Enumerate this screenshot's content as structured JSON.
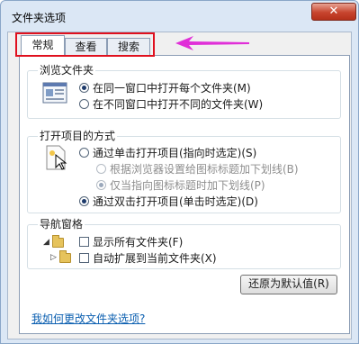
{
  "window": {
    "title": "文件夹选项",
    "close_label": "✕"
  },
  "tabs": [
    {
      "label": "常规",
      "active": true
    },
    {
      "label": "查看",
      "active": false
    },
    {
      "label": "搜索",
      "active": false
    }
  ],
  "browse_group": {
    "title": "浏览文件夹",
    "options": [
      {
        "label": "在同一窗口中打开每个文件夹(M)",
        "checked": true
      },
      {
        "label": "在不同窗口中打开不同的文件夹(W)",
        "checked": false
      }
    ]
  },
  "click_group": {
    "title": "打开项目的方式",
    "options": [
      {
        "label": "通过单击打开项目(指向时选定)(S)",
        "checked": false,
        "enabled": true
      },
      {
        "label": "根据浏览器设置给图标标题加下划线(B)",
        "checked": false,
        "enabled": false
      },
      {
        "label": "仅当指向图标标题时加下划线(P)",
        "checked": true,
        "enabled": false
      },
      {
        "label": "通过双击打开项目(单击时选定)(D)",
        "checked": true,
        "enabled": true
      }
    ]
  },
  "nav_group": {
    "title": "导航窗格",
    "options": [
      {
        "label": "显示所有文件夹(F)",
        "checked": false
      },
      {
        "label": "自动扩展到当前文件夹(X)",
        "checked": false
      }
    ]
  },
  "restore_button": "还原为默认值(R)",
  "help_link": "我如何更改文件夹选项?",
  "annotation_color": "#e0101e",
  "arrow_color": "#e02fd8"
}
